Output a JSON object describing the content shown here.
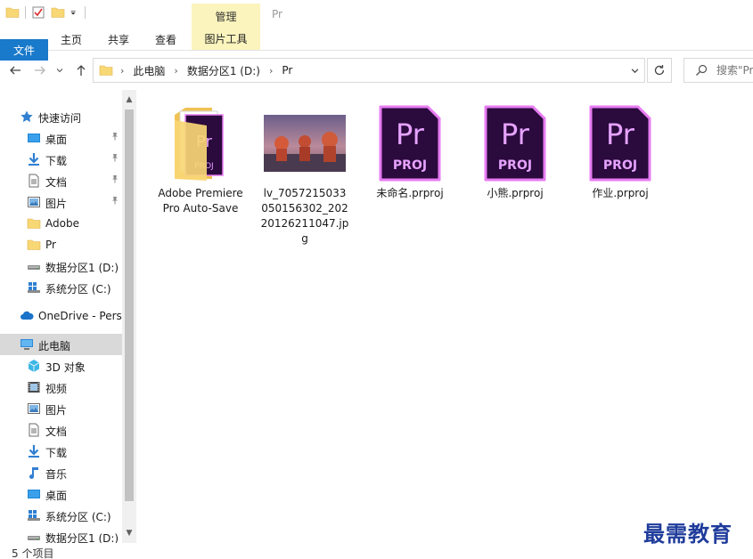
{
  "titlebar": {
    "context_tab": "管理",
    "title": "Pr"
  },
  "ribbon": {
    "file": "文件",
    "home": "主页",
    "share": "共享",
    "view": "查看",
    "picture_tools": "图片工具"
  },
  "address": {
    "path": [
      "此电脑",
      "数据分区1 (D:)",
      "Pr"
    ]
  },
  "search": {
    "placeholder": "搜索\"Pr\""
  },
  "sidebar": {
    "items": [
      {
        "label": "快速访问",
        "icon": "star-icon",
        "indent": 0,
        "pinned": false
      },
      {
        "label": "桌面",
        "icon": "desktop-icon",
        "indent": 1,
        "pinned": true
      },
      {
        "label": "下载",
        "icon": "download-icon",
        "indent": 1,
        "pinned": true
      },
      {
        "label": "文档",
        "icon": "document-icon",
        "indent": 1,
        "pinned": true
      },
      {
        "label": "图片",
        "icon": "picture-icon",
        "indent": 1,
        "pinned": true
      },
      {
        "label": "Adobe",
        "icon": "folder-icon",
        "indent": 1,
        "pinned": false
      },
      {
        "label": "Pr",
        "icon": "folder-icon",
        "indent": 1,
        "pinned": false
      },
      {
        "label": "数据分区1 (D:)",
        "icon": "drive-icon",
        "indent": 1,
        "pinned": false
      },
      {
        "label": "系统分区 (C:)",
        "icon": "system-drive-icon",
        "indent": 1,
        "pinned": false
      },
      {
        "label": "OneDrive - Personal",
        "icon": "cloud-icon",
        "indent": 0,
        "pinned": false
      },
      {
        "label": "此电脑",
        "icon": "computer-icon",
        "indent": 0,
        "pinned": false,
        "selected": true
      },
      {
        "label": "3D 对象",
        "icon": "cube-icon",
        "indent": 1,
        "pinned": false
      },
      {
        "label": "视频",
        "icon": "video-icon",
        "indent": 1,
        "pinned": false
      },
      {
        "label": "图片",
        "icon": "picture-icon",
        "indent": 1,
        "pinned": false
      },
      {
        "label": "文档",
        "icon": "document-icon",
        "indent": 1,
        "pinned": false
      },
      {
        "label": "下载",
        "icon": "download-icon",
        "indent": 1,
        "pinned": false
      },
      {
        "label": "音乐",
        "icon": "music-icon",
        "indent": 1,
        "pinned": false
      },
      {
        "label": "桌面",
        "icon": "desktop-icon",
        "indent": 1,
        "pinned": false
      },
      {
        "label": "系统分区 (C:)",
        "icon": "system-drive-icon",
        "indent": 1,
        "pinned": false
      },
      {
        "label": "数据分区1 (D:)",
        "icon": "drive-icon",
        "indent": 1,
        "pinned": false
      }
    ]
  },
  "files": [
    {
      "name": "Adobe Premiere Pro Auto-Save",
      "kind": "folder"
    },
    {
      "name": "lv_7057215033050156302_20220126211047.jpg",
      "kind": "image"
    },
    {
      "name": "未命名.prproj",
      "kind": "prproj"
    },
    {
      "name": "小熊.prproj",
      "kind": "prproj"
    },
    {
      "name": "作业.prproj",
      "kind": "prproj"
    }
  ],
  "pr_icon": {
    "top": "Pr",
    "bottom": "PROJ"
  },
  "status": {
    "count": "5 个项目"
  },
  "watermark": "最需教育",
  "colors": {
    "accent": "#1979ca",
    "pr_bg": "#2b0a3d",
    "pr_border": "#e77cf2",
    "pr_text": "#e6a3ff",
    "context_tab": "#fbf4bd"
  }
}
